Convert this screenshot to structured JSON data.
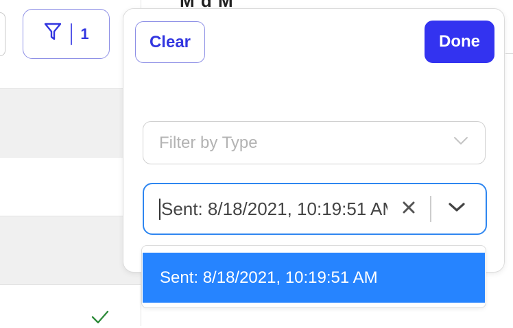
{
  "toolbar": {
    "filter_count": "1",
    "icons": {
      "filter": "funnel-icon"
    }
  },
  "background": {
    "heading_partial": "M   d   M",
    "row_status_icon": "checkmark-icon",
    "check_color": "#2e8b3a"
  },
  "popover": {
    "clear_label": "Clear",
    "done_label": "Done",
    "type_filter": {
      "placeholder": "Filter by Type"
    },
    "date_filter": {
      "value": "Sent: 8/18/2021, 10:19:51 AM"
    },
    "options": [
      {
        "label": "Sent: 8/18/2021, 10:19:51 AM",
        "selected": true
      }
    ]
  },
  "colors": {
    "accent": "#3333f0",
    "accent_border": "#8e90e6",
    "focus_border": "#2e86f0",
    "option_highlight": "#2684ff"
  }
}
